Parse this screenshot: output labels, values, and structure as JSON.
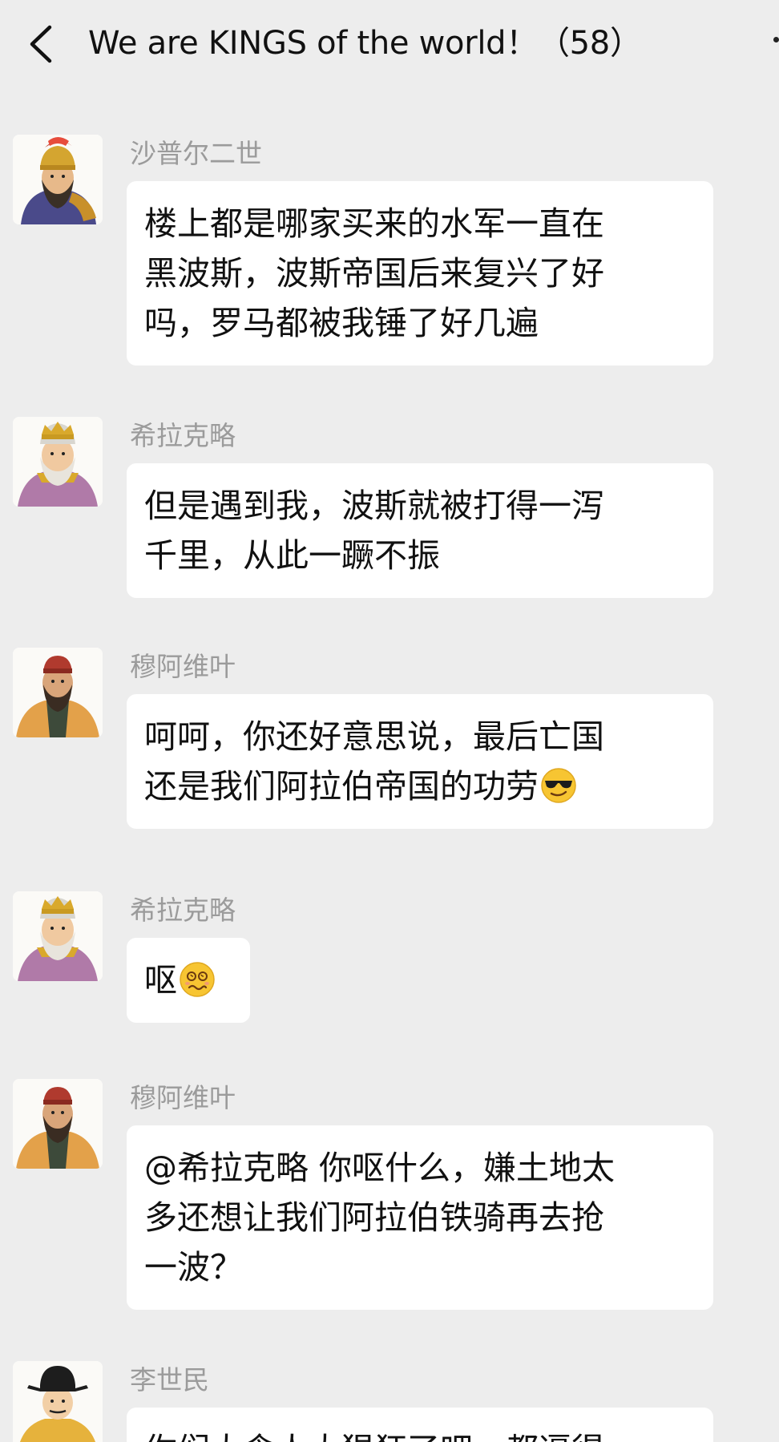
{
  "header": {
    "title": "We are KINGS of the world！（58）",
    "back_icon": "chevron-left-icon",
    "more_icon": "more-dots-icon"
  },
  "messages": [
    {
      "sender": "沙普尔二世",
      "avatar": "persian-king-avatar",
      "lines": [
        "楼上都是哪家买来的水军一直在",
        "黑波斯，波斯帝国后来复兴了好",
        "吗，罗马都被我锤了好几遍"
      ]
    },
    {
      "sender": "希拉克略",
      "avatar": "byzantine-emperor-avatar",
      "lines": [
        "但是遇到我，波斯就被打得一泻",
        "千里，从此一蹶不振"
      ]
    },
    {
      "sender": "穆阿维叶",
      "avatar": "arab-caliph-avatar",
      "lines": [
        "呵呵，你还好意思说，最后亡国",
        "还是我们阿拉伯帝国的功劳"
      ],
      "emoji": "sunglasses-emoji"
    },
    {
      "sender": "希拉克略",
      "avatar": "byzantine-emperor-avatar",
      "lines": [
        "呕"
      ],
      "emoji": "nauseated-emoji"
    },
    {
      "sender": "穆阿维叶",
      "avatar": "arab-caliph-avatar",
      "lines": [
        "@希拉克略 你呕什么，嫌土地太",
        "多还想让我们阿拉伯铁骑再去抢",
        "一波？"
      ]
    },
    {
      "sender": "李世民",
      "avatar": "tang-emperor-avatar",
      "lines": [
        "你们大食人太猖狂了吧，都逼得"
      ]
    }
  ],
  "colors": {
    "background": "#ededed",
    "bubble": "#ffffff",
    "sender_name": "#9b9b9b",
    "text": "#111111"
  }
}
